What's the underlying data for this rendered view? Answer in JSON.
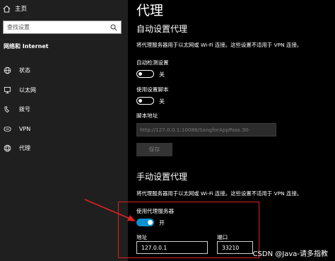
{
  "sidebar": {
    "home_label": "主页",
    "search_placeholder": "查找设置",
    "section_header": "网络和 Internet",
    "items": [
      {
        "label": "状态",
        "icon": "globe-icon"
      },
      {
        "label": "以太网",
        "icon": "ethernet-icon"
      },
      {
        "label": "拨号",
        "icon": "dialup-icon"
      },
      {
        "label": "VPN",
        "icon": "vpn-icon"
      },
      {
        "label": "代理",
        "icon": "proxy-globe-icon"
      }
    ]
  },
  "main": {
    "title": "代理",
    "auto": {
      "heading": "自动设置代理",
      "description": "将代理服务器用于以太网或 Wi-Fi 连接。这些设置不适用于 VPN 连接。",
      "detect_label": "自动检测设置",
      "detect_state": "关",
      "script_label": "使用设置脚本",
      "script_state": "关",
      "script_address_label": "脚本地址",
      "script_address_value": "http://127.0.0.1:10088/SangforAppPass.30-",
      "save_label": "保存"
    },
    "manual": {
      "heading": "手动设置代理",
      "description": "将代理服务器用于以太网或 Wi-Fi 连接。这些设置不适用于 VPN 连接。",
      "use_proxy_label": "使用代理服务器",
      "use_proxy_state": "开",
      "address_label": "地址",
      "address_value": "127.0.0.1",
      "port_label": "端口",
      "port_value": "33210"
    }
  },
  "watermark": "CSDN @Java-请多指教",
  "colors": {
    "accent": "#0a8fd0",
    "highlight_red": "#e02020",
    "sidebar_bg": "#1f1f1f",
    "panel_bg": "#000000"
  }
}
